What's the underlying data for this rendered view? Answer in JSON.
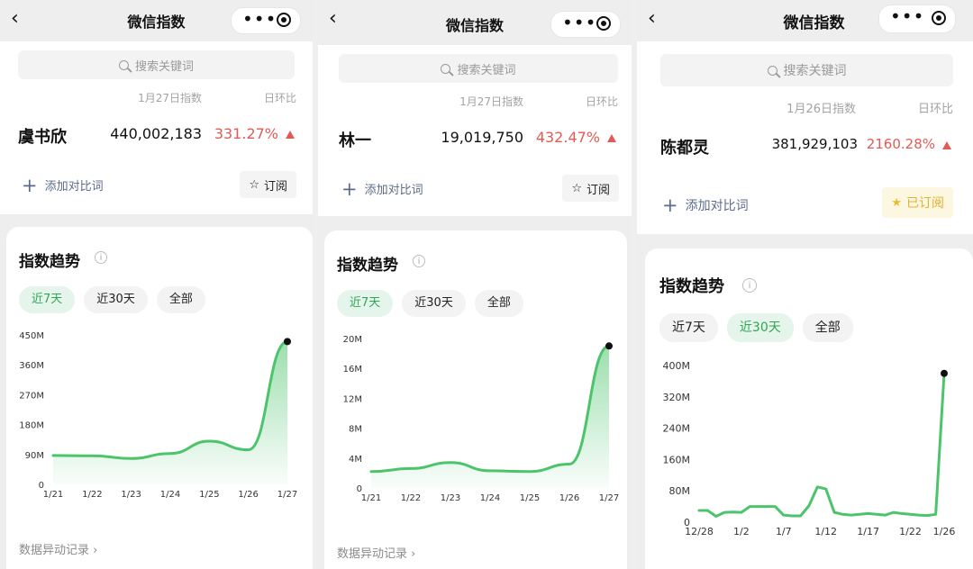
{
  "screens": [
    {
      "header": {
        "title": "微信指数"
      },
      "search": {
        "placeholder": "搜索关键词"
      },
      "summary": {
        "date_label": "1月27日指数",
        "dod_label": "日环比",
        "keyword": "虞书欣",
        "value": "440,002,183",
        "change": "331.27%",
        "change_direction": "up"
      },
      "actions": {
        "compare_label": "添加对比词",
        "subscribe_label": "订阅",
        "subscribed": false
      },
      "trend": {
        "title": "指数趋势",
        "tabs": [
          "近7天",
          "近30天",
          "全部"
        ],
        "active_tab": "近7天",
        "history_label": "数据异动记录"
      },
      "chart_data": {
        "type": "area",
        "x": [
          "1/21",
          "1/22",
          "1/23",
          "1/24",
          "1/25",
          "1/26",
          "1/27"
        ],
        "values": [
          87,
          86,
          78,
          93,
          130,
          104,
          430
        ],
        "ylim": [
          0,
          450
        ],
        "y_ticks": [
          "0",
          "90M",
          "180M",
          "270M",
          "360M",
          "450M"
        ],
        "y_tick_values": [
          0,
          90,
          180,
          270,
          360,
          450
        ],
        "x_tick_labels": [
          "1/21",
          "1/22",
          "1/23",
          "1/24",
          "1/25",
          "1/26",
          "1/27"
        ],
        "grid": false,
        "color": "#4cc46c"
      }
    },
    {
      "header": {
        "title": "微信指数"
      },
      "search": {
        "placeholder": "搜索关键词"
      },
      "summary": {
        "date_label": "1月27日指数",
        "dod_label": "日环比",
        "keyword": "林一",
        "value": "19,019,750",
        "change": "432.47%",
        "change_direction": "up"
      },
      "actions": {
        "compare_label": "添加对比词",
        "subscribe_label": "订阅",
        "subscribed": false
      },
      "trend": {
        "title": "指数趋势",
        "tabs": [
          "近7天",
          "近30天",
          "全部"
        ],
        "active_tab": "近7天",
        "history_label": "数据异动记录"
      },
      "chart_data": {
        "type": "area",
        "x": [
          "1/21",
          "1/22",
          "1/23",
          "1/24",
          "1/25",
          "1/26",
          "1/27"
        ],
        "values": [
          2.2,
          2.6,
          3.4,
          2.3,
          2.2,
          3.2,
          19.0
        ],
        "ylim": [
          0,
          20
        ],
        "y_ticks": [
          "0",
          "4M",
          "8M",
          "12M",
          "16M",
          "20M"
        ],
        "y_tick_values": [
          0,
          4,
          8,
          12,
          16,
          20
        ],
        "x_tick_labels": [
          "1/21",
          "1/22",
          "1/23",
          "1/24",
          "1/25",
          "1/26",
          "1/27"
        ],
        "grid": false,
        "color": "#4cc46c"
      }
    },
    {
      "header": {
        "title": "微信指数"
      },
      "search": {
        "placeholder": "搜索关键词"
      },
      "summary": {
        "date_label": "1月26日指数",
        "dod_label": "日环比",
        "keyword": "陈都灵",
        "value": "381,929,103",
        "change": "2160.28%",
        "change_direction": "up"
      },
      "actions": {
        "compare_label": "添加对比词",
        "subscribe_label": "已订阅",
        "subscribed": true
      },
      "trend": {
        "title": "指数趋势",
        "tabs": [
          "近7天",
          "近30天",
          "全部"
        ],
        "active_tab": "近30天",
        "history_label": ""
      },
      "chart_data": {
        "type": "line",
        "x": [
          "12/28",
          "12/29",
          "12/30",
          "12/31",
          "1/1",
          "1/2",
          "1/3",
          "1/4",
          "1/5",
          "1/6",
          "1/7",
          "1/8",
          "1/9",
          "1/10",
          "1/11",
          "1/12",
          "1/13",
          "1/14",
          "1/15",
          "1/16",
          "1/17",
          "1/18",
          "1/19",
          "1/20",
          "1/21",
          "1/22",
          "1/23",
          "1/24",
          "1/25",
          "1/26"
        ],
        "values": [
          30,
          30,
          15,
          25,
          26,
          25,
          40,
          40,
          40,
          40,
          18,
          16,
          16,
          42,
          90,
          85,
          25,
          20,
          18,
          20,
          22,
          20,
          18,
          25,
          22,
          20,
          18,
          17,
          20,
          380
        ],
        "ylim": [
          0,
          400
        ],
        "y_ticks": [
          "0",
          "80M",
          "160M",
          "240M",
          "320M",
          "400M"
        ],
        "y_tick_values": [
          0,
          80,
          160,
          240,
          320,
          400
        ],
        "x_tick_labels": [
          "12/28",
          "1/2",
          "1/7",
          "1/12",
          "1/17",
          "1/22",
          "1/26"
        ],
        "grid": false,
        "color": "#4cc46c"
      }
    }
  ]
}
